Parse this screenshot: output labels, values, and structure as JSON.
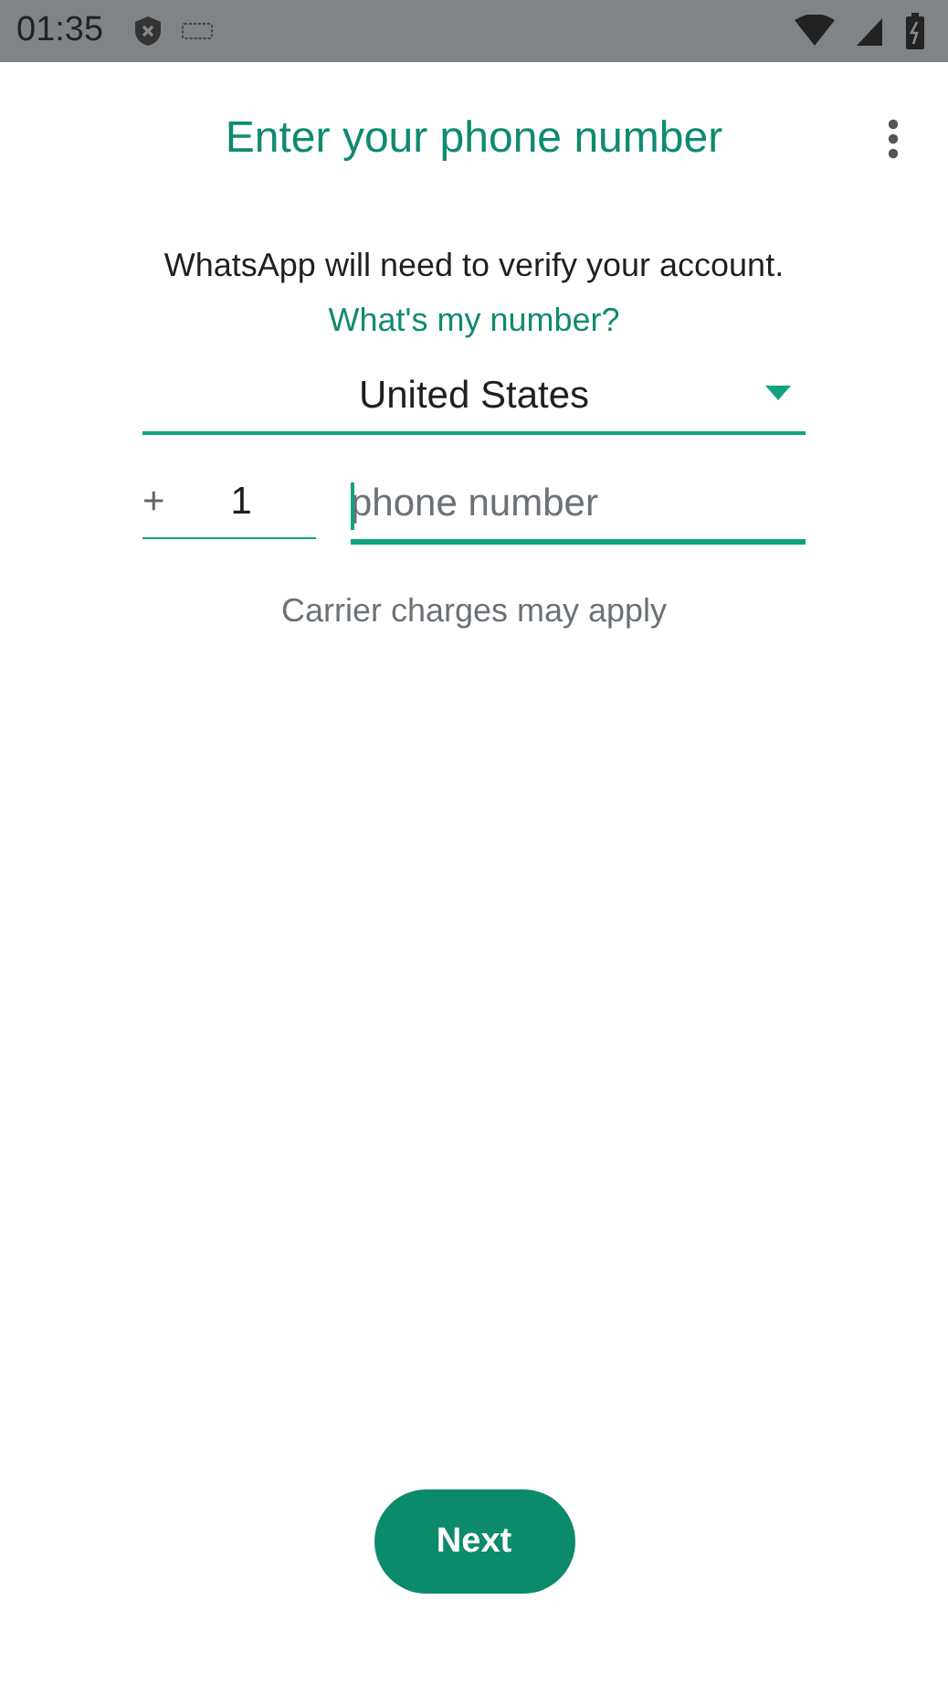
{
  "status_bar": {
    "time": "01:35"
  },
  "title": "Enter your phone number",
  "intro": {
    "text": "WhatsApp will need to verify your account.",
    "link": "What's my number?"
  },
  "country": {
    "value": "United States"
  },
  "country_code": {
    "prefix": "+",
    "value": "1"
  },
  "phone": {
    "placeholder": "phone number"
  },
  "note": "Carrier charges may apply",
  "button": "Next"
}
